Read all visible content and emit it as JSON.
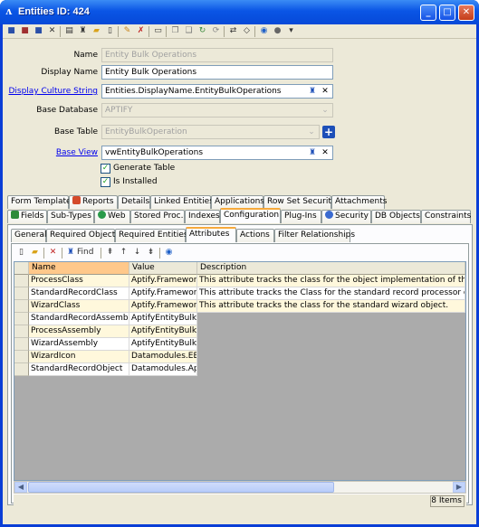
{
  "window": {
    "title": "Entities ID: 424",
    "logo": "ʌ"
  },
  "titlebar_buttons": {
    "minimize": "_",
    "maximize": "□",
    "close": "✕"
  },
  "form": {
    "name_label": "Name",
    "name_value": "Entity Bulk Operations",
    "display_name_label": "Display Name",
    "display_name_value": "Entity Bulk Operations",
    "display_culture_label": "Display Culture String",
    "display_culture_value": "Entities.DisplayName.EntityBulkOperations",
    "base_database_label": "Base Database",
    "base_database_value": "APTIFY",
    "base_table_label": "Base Table",
    "base_table_value": "EntityBulkOperation",
    "base_view_label": "Base View",
    "base_view_value": "vwEntityBulkOperations",
    "generate_table_label": "Generate Table",
    "generate_table_checked": true,
    "is_installed_label": "Is Installed",
    "is_installed_checked": true
  },
  "tabs_row1": [
    "Form Templates",
    "Reports",
    "Details",
    "Linked Entities",
    "Applications",
    "Row Set Security",
    "Attachments"
  ],
  "tabs_row2": [
    "Fields",
    "Sub-Types",
    "Web",
    "Stored Proc.",
    "Indexes",
    "Configuration",
    "Plug-Ins",
    "Security",
    "DB Objects",
    "Constraints"
  ],
  "active_tab_row2": "Configuration",
  "subtabs": [
    "General",
    "Required Objects",
    "Required Entities",
    "Attributes",
    "Actions",
    "Filter Relationships"
  ],
  "active_subtab": "Attributes",
  "grid_toolbar": {
    "find_label": "Find"
  },
  "grid": {
    "columns": [
      "Name",
      "Value",
      "Description"
    ],
    "rows": [
      {
        "name": "ProcessClass",
        "value": "Aptify.Framework.",
        "description": "This attribute tracks the class for the object implementation of the IAptifyBu"
      },
      {
        "name": "StandardRecordClass",
        "value": "Aptify.Framework.",
        "description": "This attribute tracks the Class for the standard record processor object imp"
      },
      {
        "name": "WizardClass",
        "value": "Aptify.Framework.",
        "description": "This attribute tracks the class for the standard wizard object."
      },
      {
        "name": "StandardRecordAssembly",
        "value": "AptifyEntityBulkOp",
        "description": ""
      },
      {
        "name": "ProcessAssembly",
        "value": "AptifyEntityBulkOp",
        "description": ""
      },
      {
        "name": "WizardAssembly",
        "value": "AptifyEntityBulkOp",
        "description": ""
      },
      {
        "name": "WizardIcon",
        "value": "Datamodules.EBO\\",
        "description": ""
      },
      {
        "name": "StandardRecordObject",
        "value": "Datamodules.Aptif",
        "description": ""
      }
    ]
  },
  "status": {
    "count": "8 Items"
  },
  "colors": {
    "title_blue": "#0a55e5",
    "tab_highlight": "#f6a93b",
    "row_yellow": "#fff8dc",
    "header_selected": "#ffc88a"
  }
}
